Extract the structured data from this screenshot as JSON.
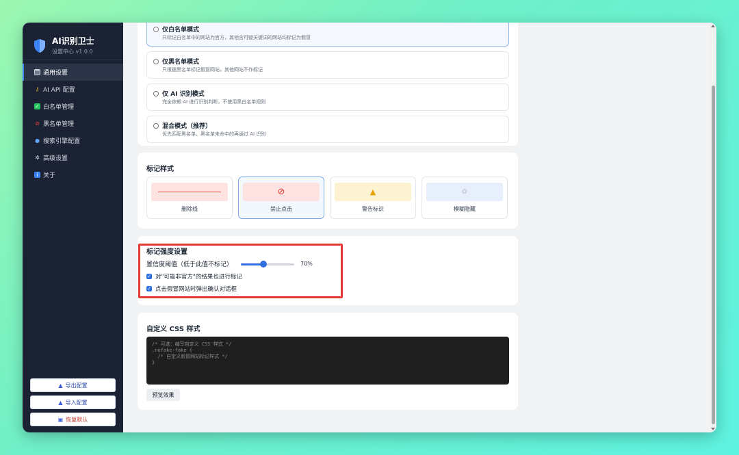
{
  "brand": {
    "title": "AI识别卫士",
    "subtitle": "设置中心 v1.0.0"
  },
  "nav": [
    {
      "label": "通用设置",
      "icon": "clipboard-icon",
      "active": true
    },
    {
      "label": "AI API 配置",
      "icon": "key-icon",
      "active": false
    },
    {
      "label": "白名单管理",
      "icon": "check-square-icon",
      "active": false
    },
    {
      "label": "黑名单管理",
      "icon": "ban-icon",
      "active": false
    },
    {
      "label": "搜索引擎配置",
      "icon": "search-icon",
      "active": false
    },
    {
      "label": "高级设置",
      "icon": "gear-icon",
      "active": false
    },
    {
      "label": "关于",
      "icon": "info-icon",
      "active": false
    }
  ],
  "footer": {
    "export_label": "导出配置",
    "import_label": "导入配置",
    "reset_label": "恢复默认"
  },
  "modes": [
    {
      "name": "仅白名单模式",
      "desc": "只标记白名单中的网站为官方，其他含可疑关键词的网站均标记为假冒",
      "selected": true
    },
    {
      "name": "仅黑名单模式",
      "desc": "只根据黑名单标记假冒网站，其他网站不作标记",
      "selected": false
    },
    {
      "name": "仅 AI 识别模式",
      "desc": "完全依赖 AI 进行识别判断，不使用黑白名单规则",
      "selected": false
    },
    {
      "name": "混合模式（推荐）",
      "desc": "优先匹配黑名单，黑名单未命中的再通过 AI 识别",
      "selected": false
    }
  ],
  "mark_style": {
    "title": "标记样式",
    "options": [
      {
        "label": "删除线",
        "selected": false
      },
      {
        "label": "禁止点击",
        "selected": true
      },
      {
        "label": "警告标识",
        "selected": false
      },
      {
        "label": "模糊隐藏",
        "selected": false
      }
    ]
  },
  "intensity": {
    "title": "标记强度设置",
    "threshold_label": "置信度阈值（低于此值不标记）",
    "threshold_value": 0.7,
    "threshold_text": "70%",
    "check1_label": "对\"可能非官方\"的结果也进行标记",
    "check2_label": "点击假冒网站时弹出确认对话框",
    "check1": true,
    "check2": true
  },
  "custom_css": {
    "title": "自定义 CSS 样式",
    "code": "/* 可选：编写自定义 CSS 样式 */\n.nofake-fake {\n  /* 自定义假冒网站标记样式 */\n}",
    "preview_label": "预览效果"
  },
  "colors": {
    "sidebar_bg": "#1b2233",
    "accent": "#2f6fe0",
    "highlight": "#e53935"
  }
}
